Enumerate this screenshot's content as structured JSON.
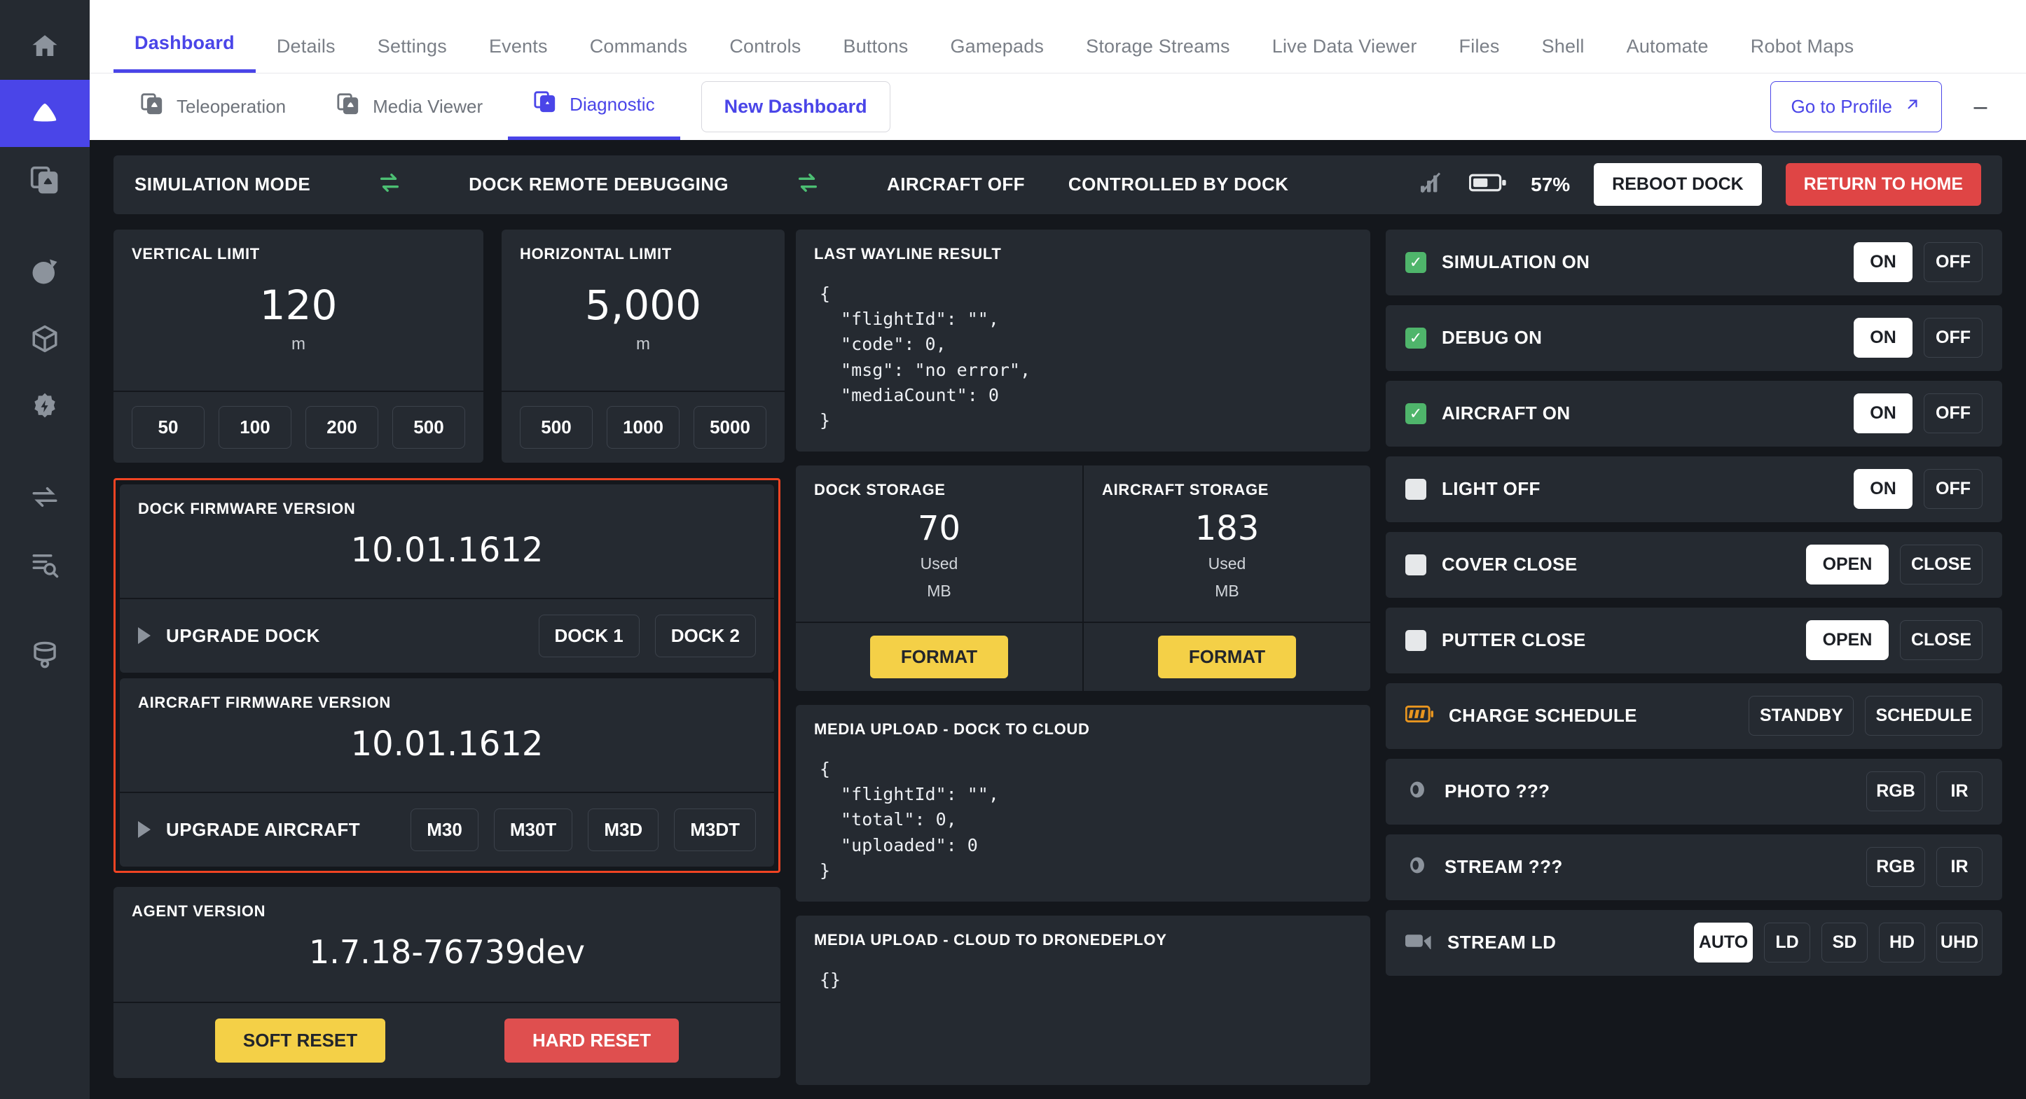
{
  "sidebar": {
    "items": [
      {
        "name": "home",
        "icon": "home-icon",
        "active": false
      },
      {
        "name": "cloud",
        "icon": "cloud-icon",
        "active": true
      },
      {
        "name": "media",
        "icon": "media-stack-icon",
        "active": false
      },
      {
        "name": "globe",
        "icon": "globe-icon",
        "active": false
      },
      {
        "name": "cube",
        "icon": "cube-icon",
        "active": false
      },
      {
        "name": "settings",
        "icon": "gear-bolt-icon",
        "active": false
      },
      {
        "name": "transfer",
        "icon": "transfer-icon",
        "active": false
      },
      {
        "name": "data-search",
        "icon": "data-search-icon",
        "active": false
      },
      {
        "name": "database",
        "icon": "database-icon",
        "active": false
      }
    ]
  },
  "tabs": [
    {
      "label": "Dashboard",
      "active": true
    },
    {
      "label": "Details",
      "active": false
    },
    {
      "label": "Settings",
      "active": false
    },
    {
      "label": "Events",
      "active": false
    },
    {
      "label": "Commands",
      "active": false
    },
    {
      "label": "Controls",
      "active": false
    },
    {
      "label": "Buttons",
      "active": false
    },
    {
      "label": "Gamepads",
      "active": false
    },
    {
      "label": "Storage Streams",
      "active": false
    },
    {
      "label": "Live Data Viewer",
      "active": false
    },
    {
      "label": "Files",
      "active": false
    },
    {
      "label": "Shell",
      "active": false
    },
    {
      "label": "Automate",
      "active": false
    },
    {
      "label": "Robot Maps",
      "active": false
    }
  ],
  "subtabs": [
    {
      "label": "Teleoperation",
      "icon": "media-stack-icon",
      "active": false
    },
    {
      "label": "Media Viewer",
      "icon": "media-stack-icon",
      "active": false
    },
    {
      "label": "Diagnostic",
      "icon": "media-stack-icon",
      "active": true
    }
  ],
  "subbar": {
    "new_dashboard_label": "New Dashboard",
    "go_to_profile_label": "Go to Profile",
    "external_link_icon": "external-link-icon",
    "minimize_label": "–"
  },
  "statusbar": {
    "mode": "SIMULATION MODE",
    "debugging": "DOCK REMOTE DEBUGGING",
    "aircraft": "AIRCRAFT OFF",
    "controlled_by": "CONTROLLED BY DOCK",
    "swap_icon": "swap-arrows-icon",
    "signal_icon": "signal-off-icon",
    "battery_icon": "battery-icon",
    "battery_percent": "57%",
    "reboot_label": "REBOOT DOCK",
    "return_home_label": "RETURN TO HOME",
    "accent_green": "#4cbf73",
    "danger_red": "#df4545"
  },
  "left": {
    "vertical_limit": {
      "title": "VERTICAL LIMIT",
      "value": "120",
      "unit": "m",
      "presets": [
        "50",
        "100",
        "200",
        "500"
      ]
    },
    "horizontal_limit": {
      "title": "HORIZONTAL LIMIT",
      "value": "5,000",
      "unit": "m",
      "presets": [
        "500",
        "1000",
        "5000"
      ]
    },
    "dock_firmware": {
      "title": "DOCK FIRMWARE VERSION",
      "value": "10.01.1612",
      "action_label": "UPGRADE DOCK",
      "options": [
        "DOCK 1",
        "DOCK 2"
      ],
      "expand_icon": "triangle-right-icon"
    },
    "aircraft_firmware": {
      "title": "AIRCRAFT FIRMWARE VERSION",
      "value": "10.01.1612",
      "action_label": "UPGRADE AIRCRAFT",
      "options": [
        "M30",
        "M30T",
        "M3D",
        "M3DT"
      ],
      "expand_icon": "triangle-right-icon"
    },
    "highlight_border_color": "#f04423",
    "agent": {
      "title": "AGENT VERSION",
      "value": "1.7.18-76739dev",
      "soft_reset_label": "SOFT RESET",
      "hard_reset_label": "HARD RESET"
    }
  },
  "middle": {
    "last_wayline": {
      "title": "LAST WAYLINE RESULT",
      "json": "{\n  \"flightId\": \"\",\n  \"code\": 0,\n  \"msg\": \"no error\",\n  \"mediaCount\": 0\n}"
    },
    "dock_storage": {
      "title": "DOCK STORAGE",
      "value": "70",
      "sub1": "Used",
      "sub2": "MB",
      "format_label": "FORMAT"
    },
    "aircraft_storage": {
      "title": "AIRCRAFT STORAGE",
      "value": "183",
      "sub1": "Used",
      "sub2": "MB",
      "format_label": "FORMAT"
    },
    "media_dock_to_cloud": {
      "title": "MEDIA UPLOAD - DOCK TO CLOUD",
      "json": "{\n  \"flightId\": \"\",\n  \"total\": 0,\n  \"uploaded\": 0\n}"
    },
    "media_cloud_to_dronedeploy": {
      "title": "MEDIA UPLOAD - CLOUD TO DRONEDEPLOY",
      "json": "{}"
    }
  },
  "right": {
    "rows": [
      {
        "label": "SIMULATION ON",
        "check": "on",
        "icon": null,
        "buttons": [
          {
            "t": "ON",
            "sel": true
          },
          {
            "t": "OFF",
            "sel": false
          }
        ]
      },
      {
        "label": "DEBUG ON",
        "check": "on",
        "icon": null,
        "buttons": [
          {
            "t": "ON",
            "sel": true
          },
          {
            "t": "OFF",
            "sel": false
          }
        ]
      },
      {
        "label": "AIRCRAFT ON",
        "check": "on",
        "icon": null,
        "buttons": [
          {
            "t": "ON",
            "sel": true
          },
          {
            "t": "OFF",
            "sel": false
          }
        ]
      },
      {
        "label": "LIGHT OFF",
        "check": "off",
        "icon": null,
        "buttons": [
          {
            "t": "ON",
            "sel": true
          },
          {
            "t": "OFF",
            "sel": false
          }
        ]
      },
      {
        "label": "COVER CLOSE",
        "check": "off",
        "icon": null,
        "buttons": [
          {
            "t": "OPEN",
            "sel": true
          },
          {
            "t": "CLOSE",
            "sel": false
          }
        ]
      },
      {
        "label": "PUTTER CLOSE",
        "check": "off",
        "icon": null,
        "buttons": [
          {
            "t": "OPEN",
            "sel": true
          },
          {
            "t": "CLOSE",
            "sel": false
          }
        ]
      },
      {
        "label": "CHARGE SCHEDULE",
        "check": null,
        "icon": "battery-charge-icon",
        "buttons": [
          {
            "t": "STANDBY",
            "sel": false
          },
          {
            "t": "SCHEDULE",
            "sel": false
          }
        ]
      },
      {
        "label": "PHOTO ???",
        "check": null,
        "icon": "aperture-icon",
        "buttons": [
          {
            "t": "RGB",
            "sel": false
          },
          {
            "t": "IR",
            "sel": false
          }
        ]
      },
      {
        "label": "STREAM ???",
        "check": null,
        "icon": "aperture-icon",
        "buttons": [
          {
            "t": "RGB",
            "sel": false
          },
          {
            "t": "IR",
            "sel": false
          }
        ]
      },
      {
        "label": "STREAM LD",
        "check": null,
        "icon": "video-camera-icon",
        "buttons": [
          {
            "t": "AUTO",
            "sel": true
          },
          {
            "t": "LD",
            "sel": false
          },
          {
            "t": "SD",
            "sel": false
          },
          {
            "t": "HD",
            "sel": false
          },
          {
            "t": "UHD",
            "sel": false
          }
        ]
      }
    ]
  }
}
